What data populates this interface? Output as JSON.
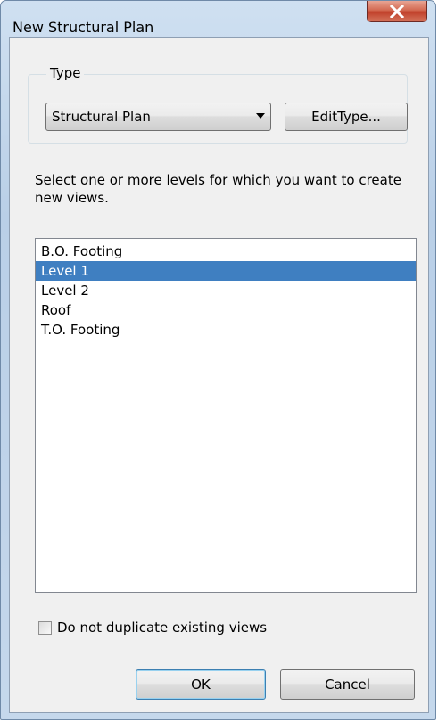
{
  "window": {
    "title": "New Structural Plan",
    "close_icon": "close-icon"
  },
  "type_group": {
    "label": "Type",
    "selected_type": "Structural Plan",
    "edit_type_label": "EditType..."
  },
  "instructions": "Select one or more levels for which you want to create new views.",
  "levels": [
    {
      "label": "B.O. Footing",
      "selected": false
    },
    {
      "label": "Level 1",
      "selected": true
    },
    {
      "label": "Level 2",
      "selected": false
    },
    {
      "label": "Roof",
      "selected": false
    },
    {
      "label": "T.O. Footing",
      "selected": false
    }
  ],
  "options": {
    "do_not_duplicate_label": "Do not duplicate existing views",
    "do_not_duplicate_checked": false
  },
  "buttons": {
    "ok": "OK",
    "cancel": "Cancel"
  },
  "colors": {
    "selection": "#3f7fc1",
    "close_button": "#c94a33"
  }
}
